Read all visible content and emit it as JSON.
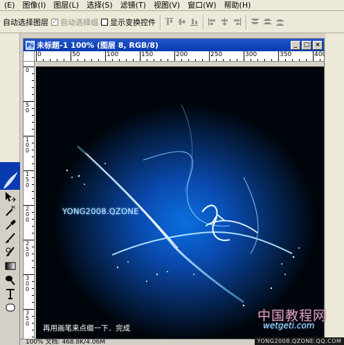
{
  "menubar": {
    "items": [
      "(E)",
      "图像(I)",
      "图层(L)",
      "选择(S)",
      "滤镜(T)",
      "视图(V)",
      "窗口(W)",
      "帮助(H)"
    ]
  },
  "options_bar": {
    "auto_select_layer": "自动选择图层",
    "auto_select_group": "自动选择组",
    "show_transform_controls": "显示变换控件",
    "auto_select_group_checked": true,
    "show_transform_checked": false
  },
  "document": {
    "title": "未标题-1 100% (图层 8, RGB/8)",
    "ruler_h_labels": [
      "0",
      "50",
      "100",
      "150",
      "200",
      "250",
      "300",
      "350",
      "400"
    ],
    "ruler_v_labels": [
      "0",
      "50",
      "100",
      "150",
      "200",
      "250",
      "300",
      "350"
    ]
  },
  "artwork": {
    "text": "YONG2008.QZONE",
    "caption": "再用画笔来点缀一下．完成",
    "glow_color": "#0a6fe0",
    "line_color": "#bfefff"
  },
  "statusbar": {
    "text": "100%    文档: 468.8K/4.06M"
  },
  "watermark": {
    "title": "中国教程网",
    "url": "wetgeti.com",
    "footer": "YONG2008.QZONE.QQ.COM"
  }
}
